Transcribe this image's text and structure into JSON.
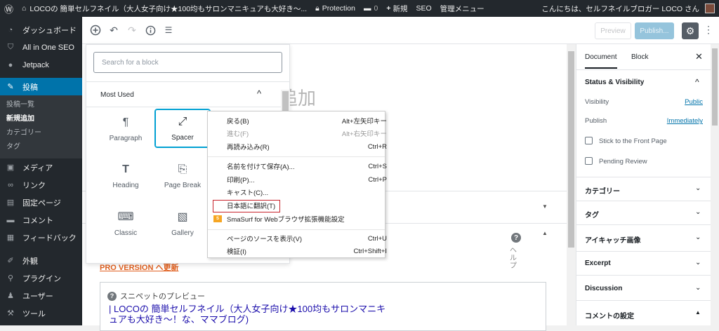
{
  "admin_bar": {
    "wp_logo_icon": "wordpress-icon",
    "home_icon": "home-icon",
    "site_name": "LOCOの 簡単セルフネイル（大人女子向け★100均もサロンマニキュアも大好き～...",
    "protection": "Protection",
    "comments_count": "0",
    "new_label": "新規",
    "seo_label": "SEO",
    "admin_menu": "管理メニュー",
    "greeting": "こんにちは、セルフネイルブロガー LOCO さん"
  },
  "sidebar": {
    "items": [
      {
        "label": "ダッシュボード",
        "icon": "dashboard-icon"
      },
      {
        "label": "All in One SEO",
        "icon": "shield-icon"
      },
      {
        "label": "Jetpack",
        "icon": "jetpack-icon"
      },
      {
        "label": "投稿",
        "icon": "pin-icon"
      },
      {
        "label": "メディア",
        "icon": "media-icon"
      },
      {
        "label": "リンク",
        "icon": "link-icon"
      },
      {
        "label": "固定ページ",
        "icon": "page-icon"
      },
      {
        "label": "コメント",
        "icon": "comment-icon"
      },
      {
        "label": "フィードバック",
        "icon": "feedback-icon"
      },
      {
        "label": "外観",
        "icon": "brush-icon"
      },
      {
        "label": "プラグイン",
        "icon": "plugin-icon"
      },
      {
        "label": "ユーザー",
        "icon": "user-icon"
      },
      {
        "label": "ツール",
        "icon": "wrench-icon"
      }
    ],
    "submenu": [
      "投稿一覧",
      "新規追加",
      "カテゴリー",
      "タグ"
    ]
  },
  "toolbar": {
    "preview_label": "Preview",
    "publish_label": "Publish..."
  },
  "editor": {
    "title_partial": "追加",
    "pro_version_link": "PRO VERSION へ更新",
    "help_label": "ヘルプ",
    "snippet_label": "スニペットのプレビュー",
    "snippet_title": "| LOCOの 簡単セルフネイル（大人女子向け★100均もサロンマニキュアも大好き～！な、ママブログ)"
  },
  "inserter": {
    "search_placeholder": "Search for a block",
    "panel_title": "Most Used",
    "blocks": [
      {
        "label": "Paragraph",
        "icon": "paragraph-icon"
      },
      {
        "label": "Spacer",
        "icon": "resize-icon"
      },
      {
        "label": "Heading",
        "icon": "heading-icon"
      },
      {
        "label": "Page Break",
        "icon": "page-break-icon"
      },
      {
        "label": "Classic",
        "icon": "keyboard-icon"
      },
      {
        "label": "Gallery",
        "icon": "gallery-icon"
      }
    ]
  },
  "context_menu": {
    "items": [
      {
        "label": "戻る(B)",
        "shortcut": "Alt+左矢印キー"
      },
      {
        "label": "進む(F)",
        "shortcut": "Alt+右矢印キー"
      },
      {
        "label": "再読み込み(R)",
        "shortcut": "Ctrl+R"
      },
      {
        "label": "名前を付けて保存(A)...",
        "shortcut": "Ctrl+S"
      },
      {
        "label": "印刷(P)...",
        "shortcut": "Ctrl+P"
      },
      {
        "label": "キャスト(C)...",
        "shortcut": ""
      },
      {
        "label": "日本語に翻訳(T)",
        "shortcut": ""
      },
      {
        "label": "SmaSurf for Webブラウザ拡張機能設定",
        "shortcut": ""
      },
      {
        "label": "ページのソースを表示(V)",
        "shortcut": "Ctrl+U"
      },
      {
        "label": "検証(I)",
        "shortcut": "Ctrl+Shift+I"
      }
    ]
  },
  "settings_panel": {
    "tab_document": "Document",
    "tab_block": "Block",
    "status_visibility": "Status & Visibility",
    "visibility_label": "Visibility",
    "visibility_value": "Public",
    "publish_label": "Publish",
    "publish_value": "Immediately",
    "stick_label": "Stick to the Front Page",
    "pending_label": "Pending Review",
    "categories": "カテゴリー",
    "tags": "タグ",
    "featured_image": "アイキャッチ画像",
    "excerpt": "Excerpt",
    "discussion": "Discussion",
    "comment_settings": "コメントの設定"
  }
}
